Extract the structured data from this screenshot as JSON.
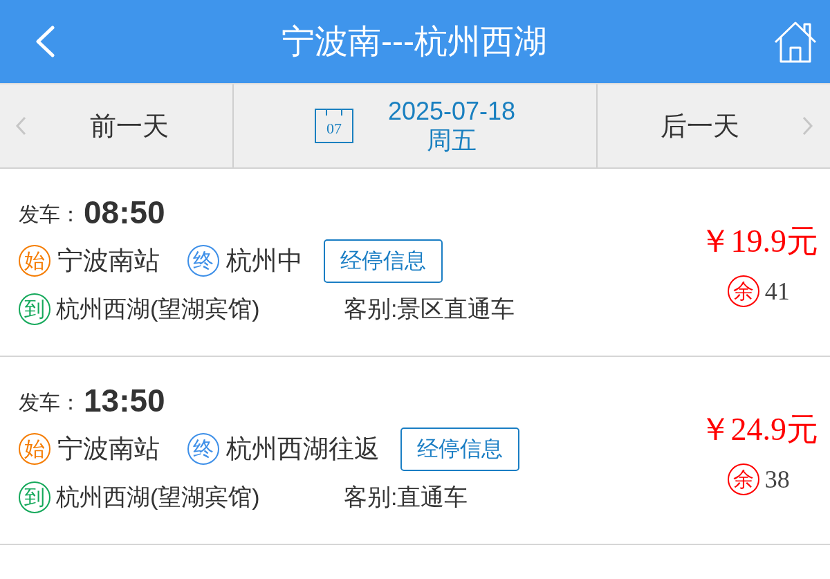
{
  "header": {
    "title": "宁波南---杭州西湖"
  },
  "date_bar": {
    "prev_label": "前一天",
    "calendar_day": "07",
    "date": "2025-07-18",
    "weekday": "周五",
    "next_label": "后一天"
  },
  "trips": [
    {
      "depart_label": "发车：",
      "depart_time": "08:50",
      "stops": [
        {
          "kind": "start",
          "badge": "始",
          "name": "宁波南站"
        },
        {
          "kind": "end",
          "badge": "终",
          "name": "杭州中"
        }
      ],
      "stops_button": "经停信息",
      "arrival": {
        "badge": "到",
        "name": "杭州西湖(望湖宾馆)"
      },
      "category": "客别:景区直通车",
      "price": "￥19.9元",
      "remaining": {
        "badge": "余",
        "count": "41"
      }
    },
    {
      "depart_label": "发车：",
      "depart_time": "13:50",
      "stops": [
        {
          "kind": "start",
          "badge": "始",
          "name": "宁波南站"
        },
        {
          "kind": "end",
          "badge": "终",
          "name": "杭州西湖往返"
        }
      ],
      "stops_button": "经停信息",
      "arrival": {
        "badge": "到",
        "name": "杭州西湖(望湖宾馆)"
      },
      "category": "客别:直通车",
      "price": "￥24.9元",
      "remaining": {
        "badge": "余",
        "count": "38"
      }
    }
  ]
}
